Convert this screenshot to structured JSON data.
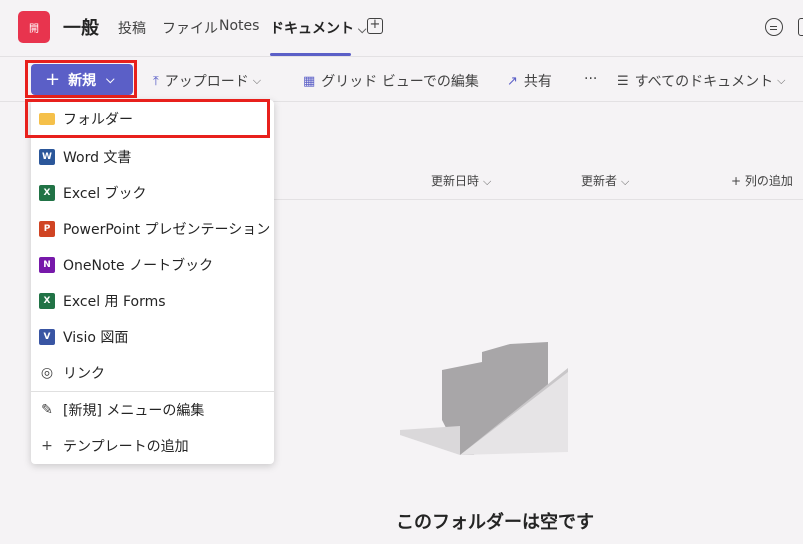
{
  "header": {
    "team_initial": "開",
    "channel_name": "一般",
    "tabs": [
      {
        "label": "投稿"
      },
      {
        "label": "ファイル"
      },
      {
        "label": "Notes"
      },
      {
        "label": "ドキュメント"
      }
    ],
    "active_tab": "ドキュメント",
    "accent_color": "#5b5fc7",
    "team_color": "#e8344e"
  },
  "toolbar": {
    "new_label": "新規",
    "upload_label": "アップロード",
    "grid_label": "グリッド ビューでの編集",
    "share_label": "共有",
    "more_label": "···",
    "view_label": "すべてのドキュメント"
  },
  "columns": {
    "modified": "更新日時",
    "modified_by": "更新者",
    "add_column": "列の追加"
  },
  "new_menu": {
    "items": [
      {
        "label": "フォルダー",
        "icon": "folder-icon"
      },
      {
        "label": "Word 文書",
        "icon": "word-icon"
      },
      {
        "label": "Excel ブック",
        "icon": "excel-icon"
      },
      {
        "label": "PowerPoint プレゼンテーション",
        "icon": "powerpoint-icon"
      },
      {
        "label": "OneNote ノートブック",
        "icon": "onenote-icon"
      },
      {
        "label": "Excel 用 Forms",
        "icon": "forms-icon"
      },
      {
        "label": "Visio 図面",
        "icon": "visio-icon"
      },
      {
        "label": "リンク",
        "icon": "globe-icon"
      }
    ],
    "footer_items": [
      {
        "label": "[新規] メニューの編集",
        "icon": "pencil-icon"
      },
      {
        "label": "テンプレートの追加",
        "icon": "plus-icon"
      }
    ]
  },
  "empty_state": {
    "title": "このフォルダーは空です"
  }
}
